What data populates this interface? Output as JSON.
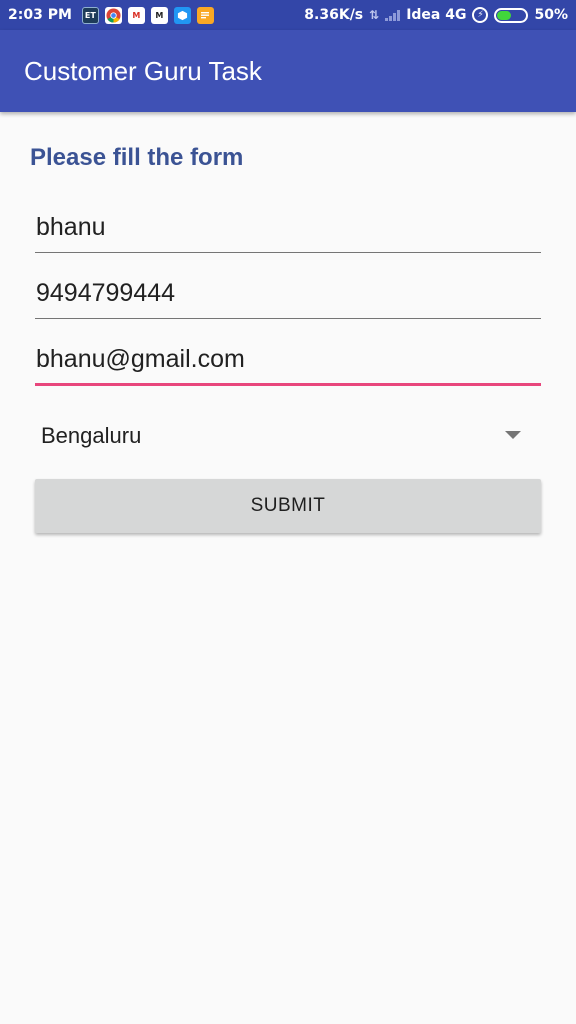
{
  "status_bar": {
    "time": "2:03 PM",
    "notifications": [
      {
        "icon": "et-app-icon",
        "label": "ET",
        "color": "#1e3c5a"
      },
      {
        "icon": "chrome-icon",
        "label": "",
        "color": "#e0e0e0"
      },
      {
        "icon": "gmail-icon",
        "label": "M",
        "color": "#ffffff"
      },
      {
        "icon": "news-app-icon",
        "label": "M",
        "color": "#ffffff"
      },
      {
        "icon": "cube-app-icon",
        "label": "",
        "color": "#2196f3"
      },
      {
        "icon": "notes-app-icon",
        "label": "",
        "color": "#f9a825"
      }
    ],
    "network_speed": "8.36K/s",
    "carrier": "Idea 4G",
    "battery": "50%",
    "battery_level": 0.5
  },
  "app_bar": {
    "title": "Customer Guru Task"
  },
  "form": {
    "heading": "Please fill the form",
    "name_value": "bhanu",
    "phone_value": "9494799444",
    "email_value": "bhanu@gmail.com",
    "city_selected": "Bengaluru",
    "submit_label": "SUBMIT"
  },
  "colors": {
    "primary": "#3f51b5",
    "primary_dark": "#3346a8",
    "accent": "#e8467c",
    "heading": "#3b5394"
  }
}
